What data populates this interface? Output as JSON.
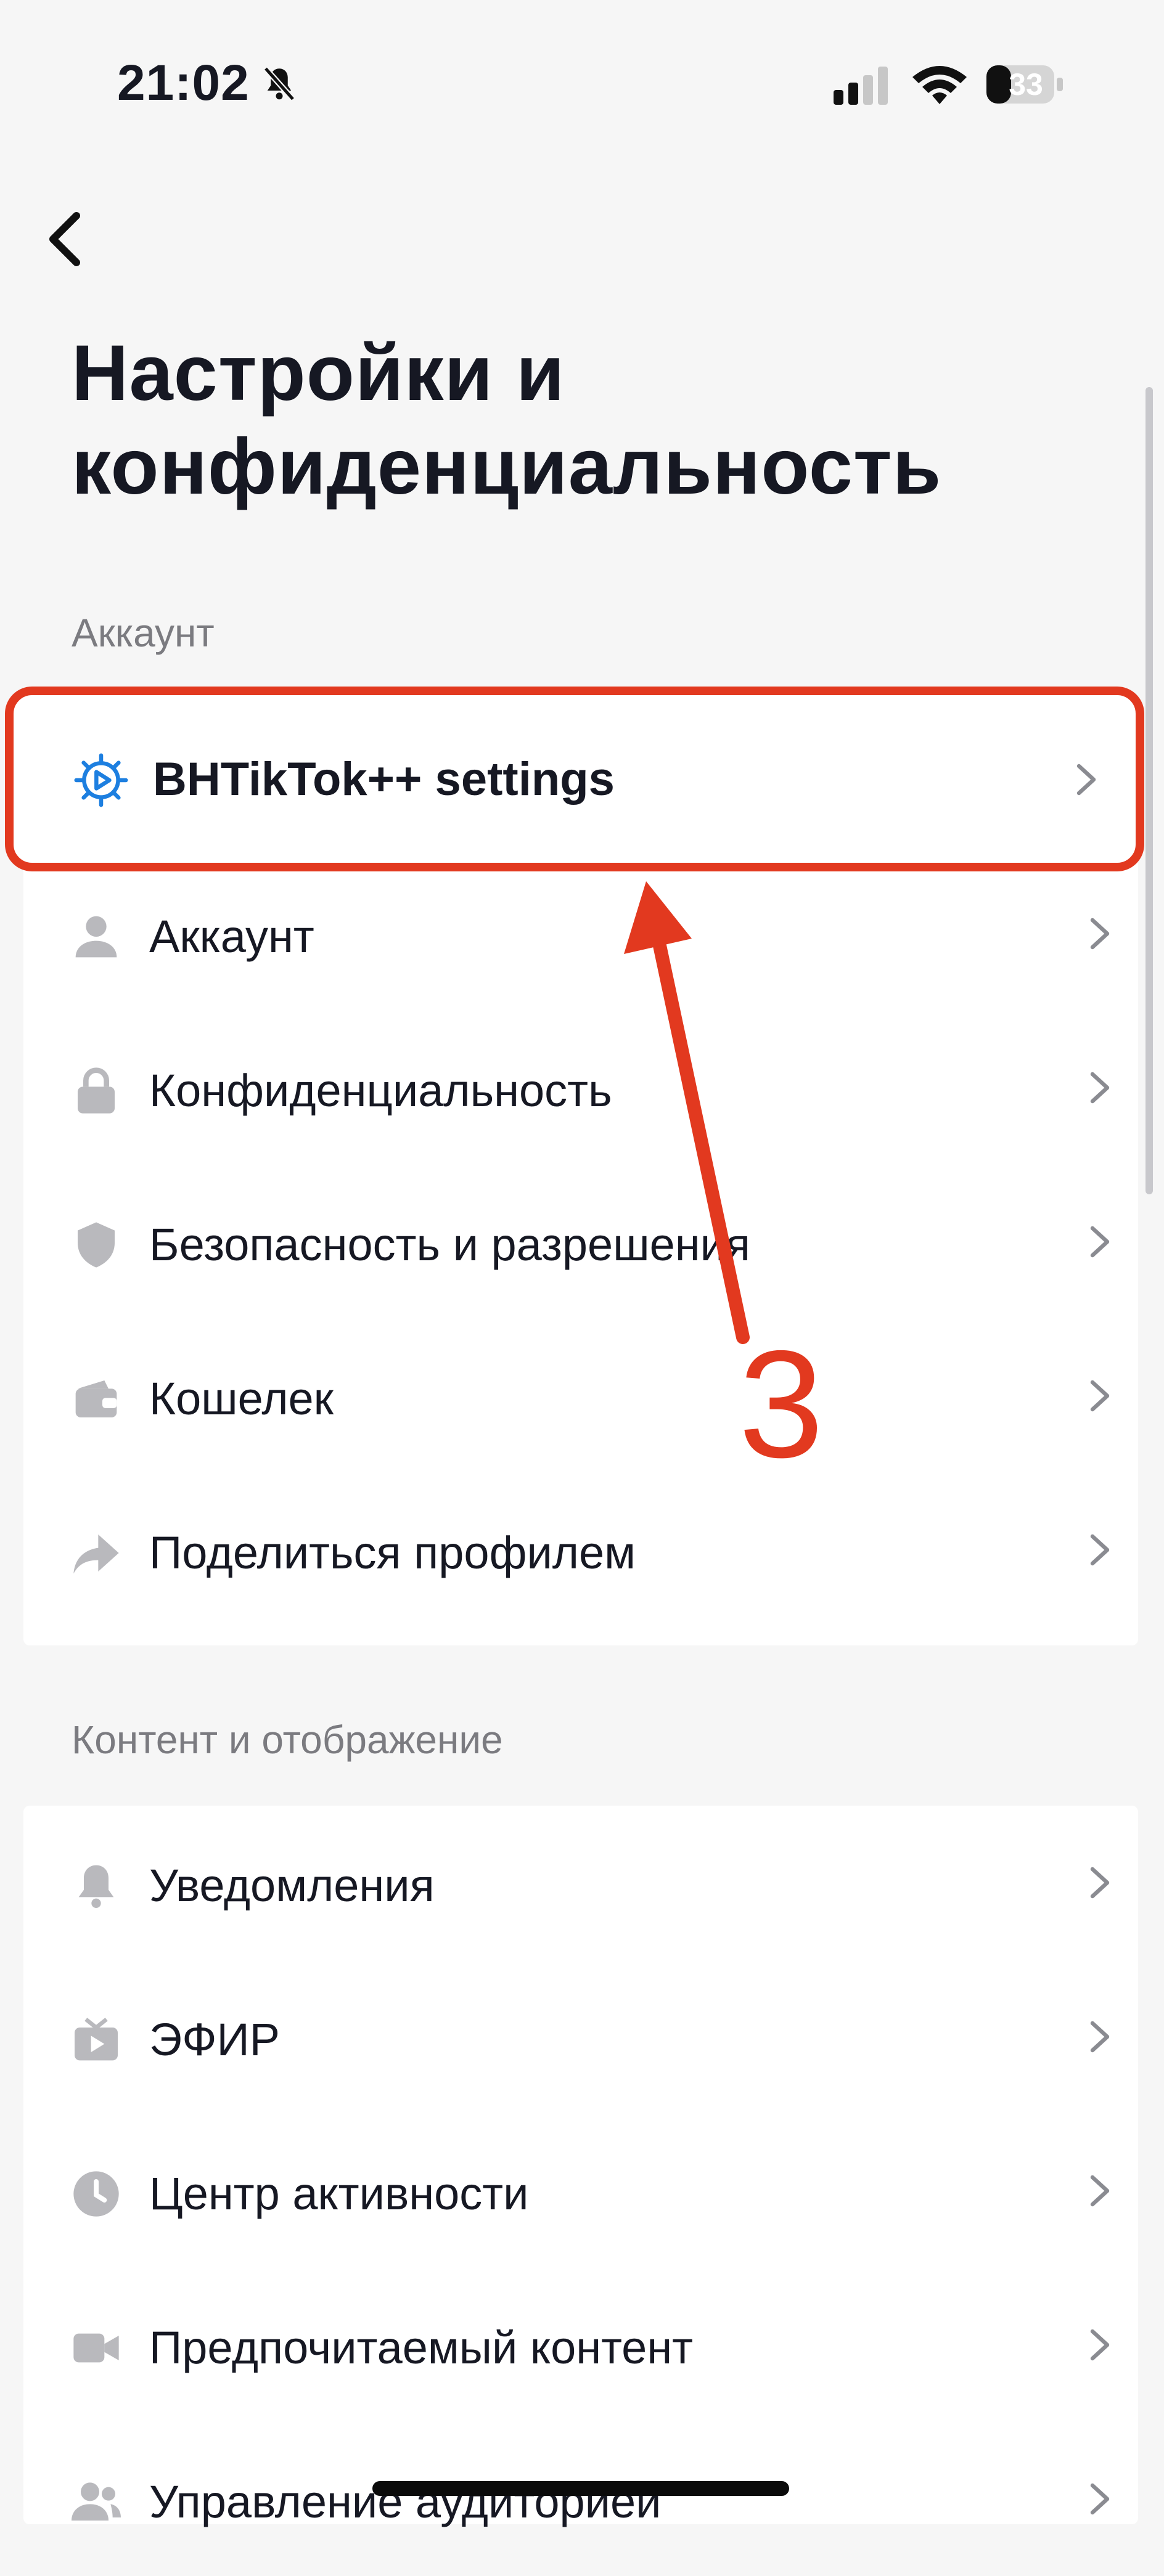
{
  "status_bar": {
    "time": "21:02",
    "battery": "33"
  },
  "header": {
    "title_line1": "Настройки и",
    "title_line2": "конфиденциальность"
  },
  "sections": {
    "account": {
      "label": "Аккаунт",
      "highlighted_item": {
        "label": "BHTikTok++ settings",
        "icon": "gear-play-icon"
      },
      "items": [
        {
          "label": "Аккаунт",
          "icon": "person-icon"
        },
        {
          "label": "Конфиденциальность",
          "icon": "lock-icon"
        },
        {
          "label": "Безопасность и разрешения",
          "icon": "shield-icon"
        },
        {
          "label": "Кошелек",
          "icon": "wallet-icon"
        },
        {
          "label": "Поделиться профилем",
          "icon": "share-arrow-icon"
        }
      ]
    },
    "content": {
      "label": "Контент и отображение",
      "items": [
        {
          "label": "Уведомления",
          "icon": "bell-icon"
        },
        {
          "label": "ЭФИР",
          "icon": "tv-icon"
        },
        {
          "label": "Центр активности",
          "icon": "clock-icon"
        },
        {
          "label": "Предпочитаемый контент",
          "icon": "video-camera-icon"
        },
        {
          "label": "Управление аудиторией",
          "icon": "people-icon"
        }
      ]
    }
  },
  "annotation": {
    "step_number": "3",
    "color": "#e2391f"
  },
  "colors": {
    "icon_gray": "#b9b9bd",
    "accent_blue": "#1d7fe0",
    "chevron": "#8a8b91"
  }
}
